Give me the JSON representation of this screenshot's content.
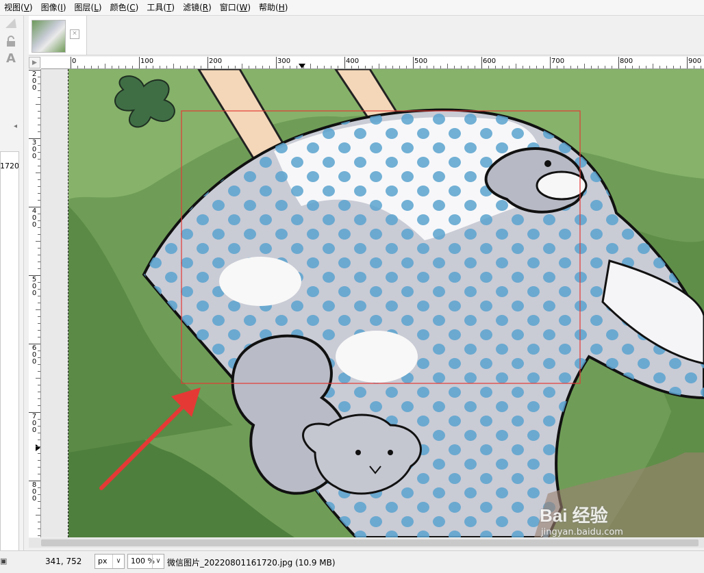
{
  "menubar": {
    "items": [
      {
        "label": "视图(",
        "key": "V",
        "end": ")"
      },
      {
        "label": "图像(",
        "key": "I",
        "end": ")"
      },
      {
        "label": "图层(",
        "key": "L",
        "end": ")"
      },
      {
        "label": "颜色(",
        "key": "C",
        "end": ")"
      },
      {
        "label": "工具(",
        "key": "T",
        "end": ")"
      },
      {
        "label": "滤镜(",
        "key": "R",
        "end": ")"
      },
      {
        "label": "窗口(",
        "key": "W",
        "end": ")"
      },
      {
        "label": "帮助(",
        "key": "H",
        "end": ")"
      }
    ]
  },
  "left_dock": {
    "panel_label": "1720]",
    "text_tool_glyph": "A"
  },
  "tabs": {
    "close_glyph": "×"
  },
  "rulers": {
    "horizontal": [
      "0",
      "100",
      "200",
      "300",
      "400",
      "500",
      "600",
      "700",
      "800",
      "900"
    ],
    "vertical": [
      "200",
      "300",
      "400",
      "500",
      "600",
      "700",
      "800"
    ]
  },
  "status": {
    "coords": "341, 752",
    "unit": "px",
    "zoom": "100 %",
    "file_info": "微信图片_20220801161720.jpg (10.9 MB)",
    "arrow_glyph": "∨"
  },
  "watermark": {
    "brand": "Bai 经验",
    "url": "jingyan.baidu.com"
  },
  "colors": {
    "selection": "#e53935",
    "arrow": "#e53935"
  }
}
